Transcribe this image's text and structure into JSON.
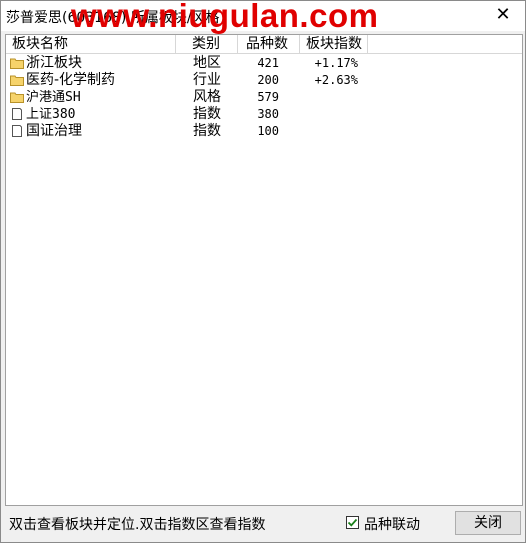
{
  "window": {
    "title": "莎普爱思(603168) 所属板块/风格",
    "watermark": "www.niugulan.com",
    "close_glyph": "✕"
  },
  "list": {
    "headers": {
      "name": "板块名称",
      "type": "类别",
      "count": "品种数",
      "index": "板块指数"
    },
    "rows": [
      {
        "icon": "folder-icon",
        "name": "浙江板块",
        "type": "地区",
        "count": "421",
        "index": "+1.17%"
      },
      {
        "icon": "folder-icon",
        "name": "医药-化学制药",
        "type": "行业",
        "count": "200",
        "index": "+2.63%"
      },
      {
        "icon": "folder-icon",
        "name": "沪港通SH",
        "type": "风格",
        "count": "579",
        "index": ""
      },
      {
        "icon": "document-icon",
        "name": "上证380",
        "type": "指数",
        "count": "380",
        "index": ""
      },
      {
        "icon": "document-icon",
        "name": "国证治理",
        "type": "指数",
        "count": "100",
        "index": ""
      }
    ]
  },
  "footer": {
    "hint": "双击查看板块并定位.双击指数区查看指数",
    "checkbox_label": "品种联动",
    "checkbox_checked": true,
    "close_button": "关闭"
  },
  "colors": {
    "watermark": "#e00000",
    "folder": "#f6d36b",
    "checkmark": "#1a7f1a"
  }
}
